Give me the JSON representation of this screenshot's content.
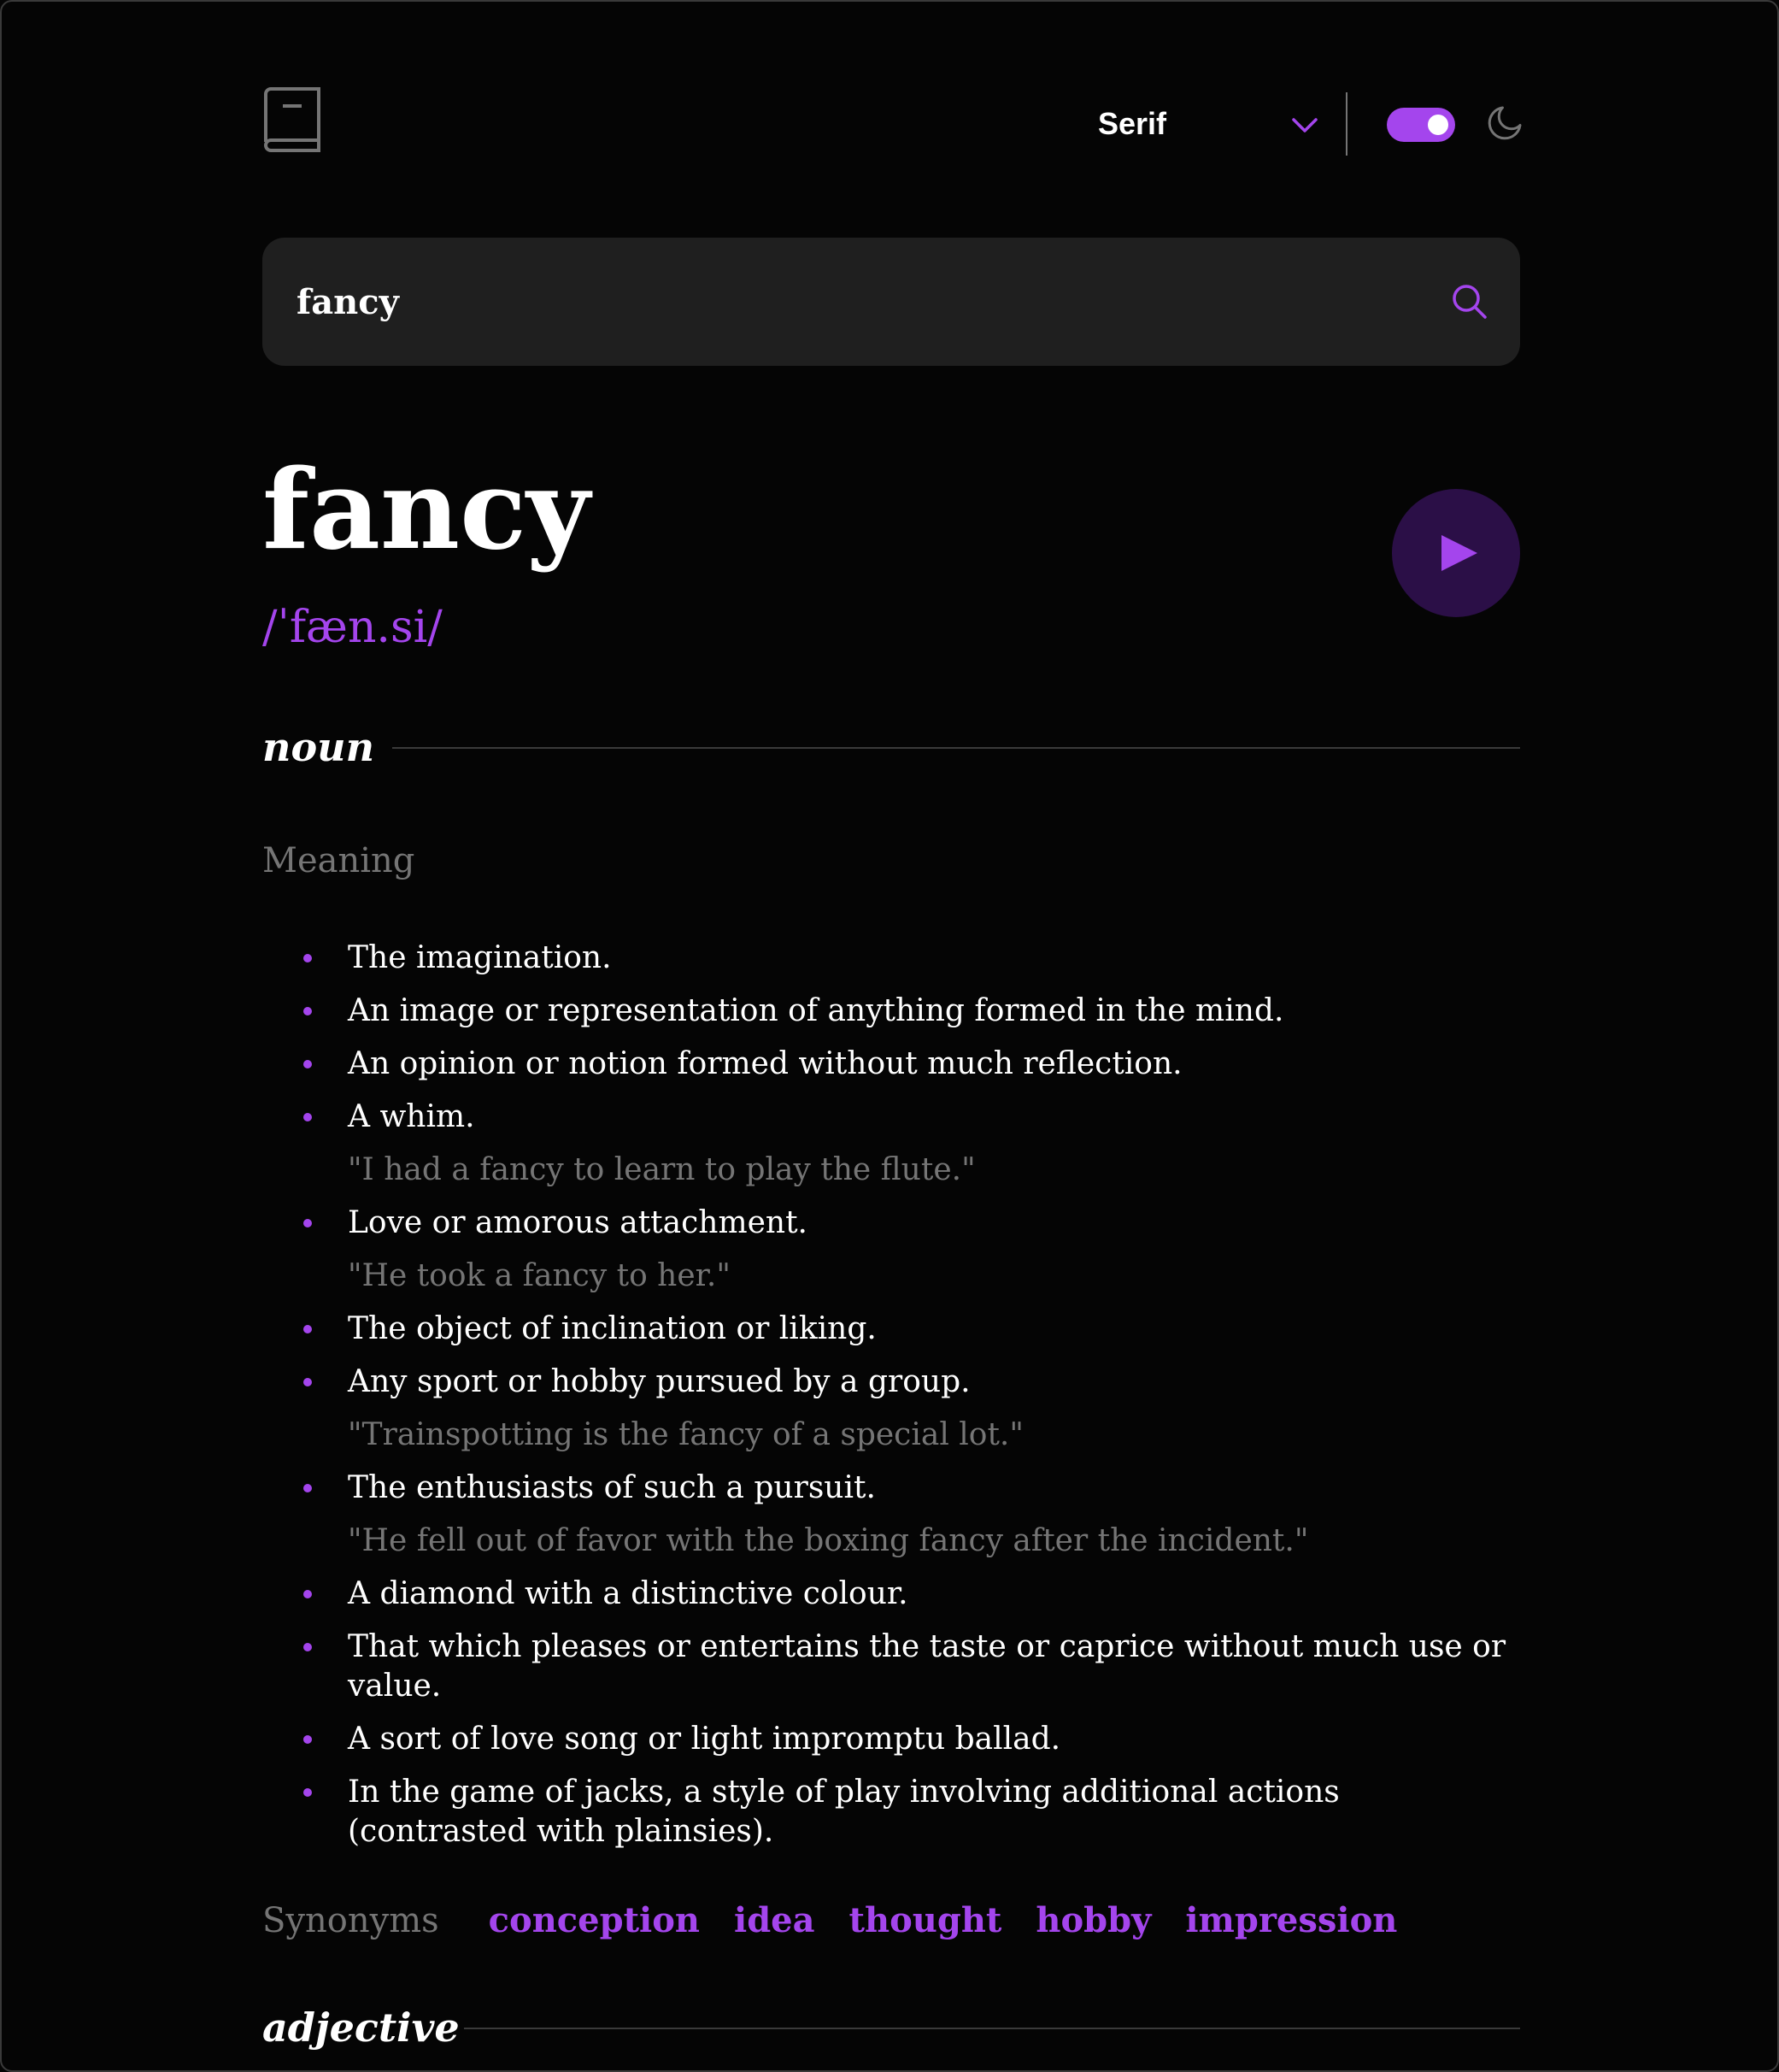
{
  "header": {
    "font_selected": "Serif",
    "theme_dark": true
  },
  "search": {
    "value": "fancy",
    "placeholder": "Search for any word…"
  },
  "entry": {
    "word": "fancy",
    "phonetic": "/ˈfæn.si/"
  },
  "meanings": [
    {
      "part_of_speech": "noun",
      "meaning_label": "Meaning",
      "definitions": [
        {
          "text": "The imagination."
        },
        {
          "text": "An image or representation of anything formed in the mind."
        },
        {
          "text": "An opinion or notion formed without much reflection."
        },
        {
          "text": "A whim.",
          "example": "\"I had a fancy to learn to play the flute.\""
        },
        {
          "text": "Love or amorous attachment.",
          "example": "\"He took a fancy to her.\""
        },
        {
          "text": "The object of inclination or liking."
        },
        {
          "text": "Any sport or hobby pursued by a group.",
          "example": "\"Trainspotting is the fancy of a special lot.\""
        },
        {
          "text": "The enthusiasts of such a pursuit.",
          "example": "\"He fell out of favor with the boxing fancy after the incident.\""
        },
        {
          "text": "A diamond with a distinctive colour."
        },
        {
          "text": "That which pleases or entertains the taste or caprice without much use or value."
        },
        {
          "text": "A sort of love song or light impromptu ballad."
        },
        {
          "text": "In the game of jacks, a style of play involving additional actions (contrasted with plainsies)."
        }
      ],
      "synonyms_label": "Synonyms",
      "synonyms": [
        "conception",
        "idea",
        "thought",
        "hobby",
        "impression"
      ]
    },
    {
      "part_of_speech": "adjective"
    }
  ],
  "colors": {
    "accent": "#a445ed",
    "background": "#050505",
    "search_bg": "#1f1f1f",
    "muted": "#757575",
    "play_bg": "#2b0f47"
  },
  "icons": {
    "logo": "book-icon",
    "dropdown": "chevron-down-icon",
    "theme": "moon-icon",
    "search": "search-icon",
    "play": "play-icon"
  }
}
